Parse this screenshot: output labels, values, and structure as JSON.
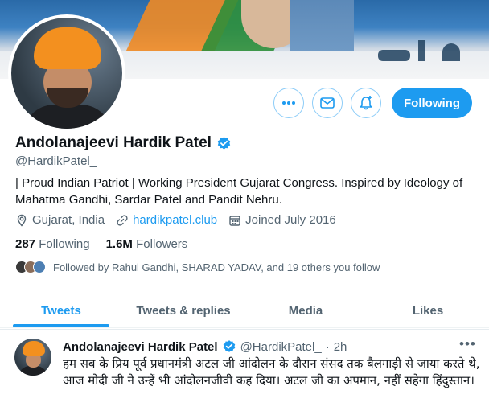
{
  "profile": {
    "display_name": "Andolanajeevi Hardik Patel",
    "handle": "@HardikPatel_",
    "bio": "| Proud Indian Patriot | Working President Gujarat Congress. Inspired by Ideology of Mahatma Gandhi, Sardar Patel and Pandit Nehru.",
    "location": "Gujarat, India",
    "website": "hardikpatel.club",
    "joined": "Joined July 2016",
    "following_count": "287",
    "following_label": "Following",
    "followers_count": "1.6M",
    "followers_label": "Followers",
    "followed_by": "Followed by Rahul Gandhi, SHARAD YADAV, and 19 others you follow"
  },
  "actions": {
    "more_icon": "more-horizontal-icon",
    "message_icon": "mail-icon",
    "notify_icon": "bell-plus-icon",
    "follow_label": "Following"
  },
  "tabs": [
    {
      "label": "Tweets",
      "active": true
    },
    {
      "label": "Tweets & replies",
      "active": false
    },
    {
      "label": "Media",
      "active": false
    },
    {
      "label": "Likes",
      "active": false
    }
  ],
  "tweet": {
    "name": "Andolanajeevi Hardik Patel",
    "handle": "@HardikPatel_",
    "dot": "·",
    "time": "2h",
    "more": "•••",
    "text": "हम सब के प्रिय पूर्व प्रधानमंत्री अटल जी आंदोलन के दौरान संसद तक बैलगाड़ी से जाया करते थे, आज मोदी जी ने उन्हें भी आंदोलनजीवी कह दिया। अटल जी का अपमान, नहीं सहेगा हिंदुस्तान।"
  },
  "colors": {
    "accent": "#1d9bf0",
    "muted": "#536471",
    "text": "#0f1419"
  }
}
